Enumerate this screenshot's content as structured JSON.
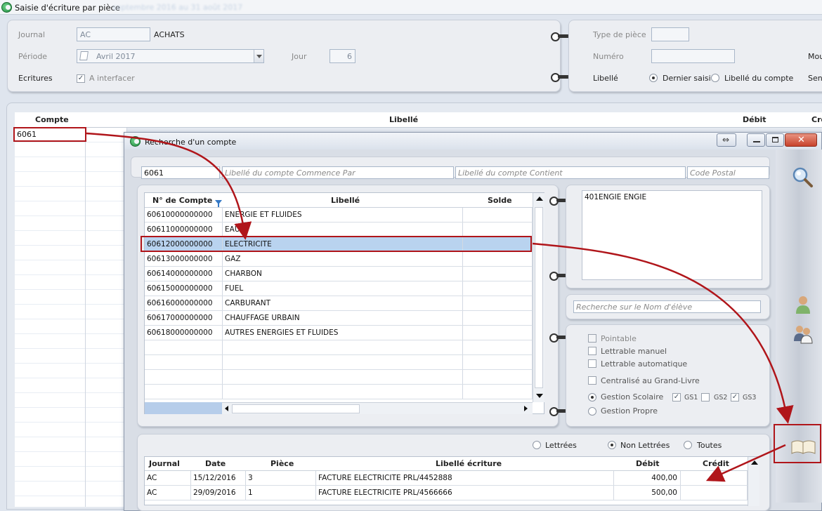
{
  "window": {
    "title": "Saisie d'écriture par pièce",
    "subtitle_blurred": "septembre 2016 au 31 août 2017"
  },
  "header_left": {
    "journal_label": "Journal",
    "journal_code": "AC",
    "journal_name": "ACHATS",
    "periode_label": "Période",
    "periode_value": "Avril 2017",
    "jour_label": "Jour",
    "jour_value": "6",
    "ecritures_label": "Ecritures",
    "interfacer_label": "A interfacer",
    "interfacer_checked": true
  },
  "header_right": {
    "type_piece_label": "Type de pièce",
    "type_piece_value": "",
    "numero_label": "Numéro",
    "numero_value": "",
    "libelle_label": "Libellé",
    "dernier_saisi_label": "Dernier saisi",
    "libelle_compte_label": "Libellé du compte",
    "selected": "Dernier saisi",
    "mou_label": "Mou",
    "sens_label": "Sens"
  },
  "main_grid": {
    "headers": [
      "Compte",
      "Libellé",
      "Débit",
      "Cré"
    ],
    "first_cell": "6061"
  },
  "dialog": {
    "title": "Recherche d'un compte",
    "search_value": "6061",
    "placeholders": {
      "commence": "Libellé du compte Commence Par",
      "contient": "Libellé du compte Contient",
      "postal": "Code Postal",
      "eleve": "Recherche sur le Nom d'élève"
    },
    "accounts_headers": [
      "N° de Compte",
      "Libellé",
      "Solde"
    ],
    "accounts": [
      {
        "num": "60610000000000",
        "lib": "ENERGIE ET FLUIDES",
        "solde": ""
      },
      {
        "num": "60611000000000",
        "lib": "EAU",
        "solde": ""
      },
      {
        "num": "60612000000000",
        "lib": "ELECTRICITE",
        "solde": ""
      },
      {
        "num": "60613000000000",
        "lib": "GAZ",
        "solde": ""
      },
      {
        "num": "60614000000000",
        "lib": "CHARBON",
        "solde": ""
      },
      {
        "num": "60615000000000",
        "lib": "FUEL",
        "solde": ""
      },
      {
        "num": "60616000000000",
        "lib": "CARBURANT",
        "solde": ""
      },
      {
        "num": "60617000000000",
        "lib": "CHAUFFAGE URBAIN",
        "solde": ""
      },
      {
        "num": "60618000000000",
        "lib": "AUTRES ENERGIES ET FLUIDES",
        "solde": ""
      }
    ],
    "selected_account": "60612000000000",
    "notes_text": "401ENGIE ENGIE",
    "options": {
      "pointable": "Pointable",
      "lettrable_manuel": "Lettrable manuel",
      "lettrable_auto": "Lettrable automatique",
      "centralise": "Centralisé au Grand-Livre",
      "gestion_scolaire": "Gestion Scolaire",
      "gestion_propre": "Gestion Propre",
      "gs1": "GS1",
      "gs2": "GS2",
      "gs3": "GS3",
      "gestion_selected": "Gestion Scolaire",
      "gs1_checked": true,
      "gs2_checked": false,
      "gs3_checked": true
    },
    "filter": {
      "lettrees": "Lettrées",
      "non_lettrees": "Non Lettrées",
      "toutes": "Toutes",
      "selected": "Non Lettrées"
    },
    "entries_headers": [
      "Journal",
      "Date",
      "Pièce",
      "Libellé écriture",
      "Débit",
      "Crédit"
    ],
    "entries": [
      {
        "journal": "AC",
        "date": "15/12/2016",
        "piece": "3",
        "libelle": "FACTURE ELECTRICITE PRL/4452888",
        "debit": "400,00",
        "credit": ""
      },
      {
        "journal": "AC",
        "date": "29/09/2016",
        "piece": "1",
        "libelle": "FACTURE ELECTRICITE PRL/4566666",
        "debit": "500,00",
        "credit": ""
      }
    ]
  },
  "colors": {
    "annotation_red": "#b0151a",
    "selection_blue": "#b9d3ef"
  }
}
